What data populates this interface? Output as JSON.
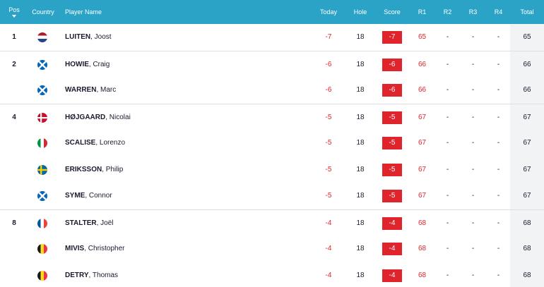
{
  "header": {
    "pos": "Pos",
    "country": "Country",
    "player": "Player Name",
    "today": "Today",
    "hole": "Hole",
    "score": "Score",
    "r1": "R1",
    "r2": "R2",
    "r3": "R3",
    "r4": "R4",
    "total": "Total"
  },
  "rows": [
    {
      "pos": "1",
      "flag": "netherlands-flag-icon",
      "surname": "LUITEN",
      "first": ", Joost",
      "today": "-7",
      "hole": "18",
      "score": "-7",
      "r1": "65",
      "r2": "-",
      "r3": "-",
      "r4": "-",
      "total": "65"
    },
    {
      "pos": "2",
      "flag": "scotland-flag-icon",
      "surname": "HOWIE",
      "first": ", Craig",
      "today": "-6",
      "hole": "18",
      "score": "-6",
      "r1": "66",
      "r2": "-",
      "r3": "-",
      "r4": "-",
      "total": "66"
    },
    {
      "pos": "",
      "flag": "scotland-flag-icon",
      "surname": "WARREN",
      "first": ", Marc",
      "today": "-6",
      "hole": "18",
      "score": "-6",
      "r1": "66",
      "r2": "-",
      "r3": "-",
      "r4": "-",
      "total": "66"
    },
    {
      "pos": "4",
      "flag": "denmark-flag-icon",
      "surname": "HØJGAARD",
      "first": ", Nicolai",
      "today": "-5",
      "hole": "18",
      "score": "-5",
      "r1": "67",
      "r2": "-",
      "r3": "-",
      "r4": "-",
      "total": "67"
    },
    {
      "pos": "",
      "flag": "italy-flag-icon",
      "surname": "SCALISE",
      "first": ", Lorenzo",
      "today": "-5",
      "hole": "18",
      "score": "-5",
      "r1": "67",
      "r2": "-",
      "r3": "-",
      "r4": "-",
      "total": "67"
    },
    {
      "pos": "",
      "flag": "sweden-flag-icon",
      "surname": "ERIKSSON",
      "first": ", Philip",
      "today": "-5",
      "hole": "18",
      "score": "-5",
      "r1": "67",
      "r2": "-",
      "r3": "-",
      "r4": "-",
      "total": "67"
    },
    {
      "pos": "",
      "flag": "scotland-flag-icon",
      "surname": "SYME",
      "first": ", Connor",
      "today": "-5",
      "hole": "18",
      "score": "-5",
      "r1": "67",
      "r2": "-",
      "r3": "-",
      "r4": "-",
      "total": "67"
    },
    {
      "pos": "8",
      "flag": "france-flag-icon",
      "surname": "STALTER",
      "first": ", Joël",
      "today": "-4",
      "hole": "18",
      "score": "-4",
      "r1": "68",
      "r2": "-",
      "r3": "-",
      "r4": "-",
      "total": "68"
    },
    {
      "pos": "",
      "flag": "belgium-flag-icon",
      "surname": "MIVIS",
      "first": ", Christopher",
      "today": "-4",
      "hole": "18",
      "score": "-4",
      "r1": "68",
      "r2": "-",
      "r3": "-",
      "r4": "-",
      "total": "68"
    },
    {
      "pos": "",
      "flag": "belgium-flag-icon",
      "surname": "DETRY",
      "first": ", Thomas",
      "today": "-4",
      "hole": "18",
      "score": "-4",
      "r1": "68",
      "r2": "-",
      "r3": "-",
      "r4": "-",
      "total": "68"
    }
  ],
  "colors": {
    "header_bg": "#2aa3c6",
    "under_par": "#e0242b",
    "total_bg": "#f2f3f5"
  }
}
